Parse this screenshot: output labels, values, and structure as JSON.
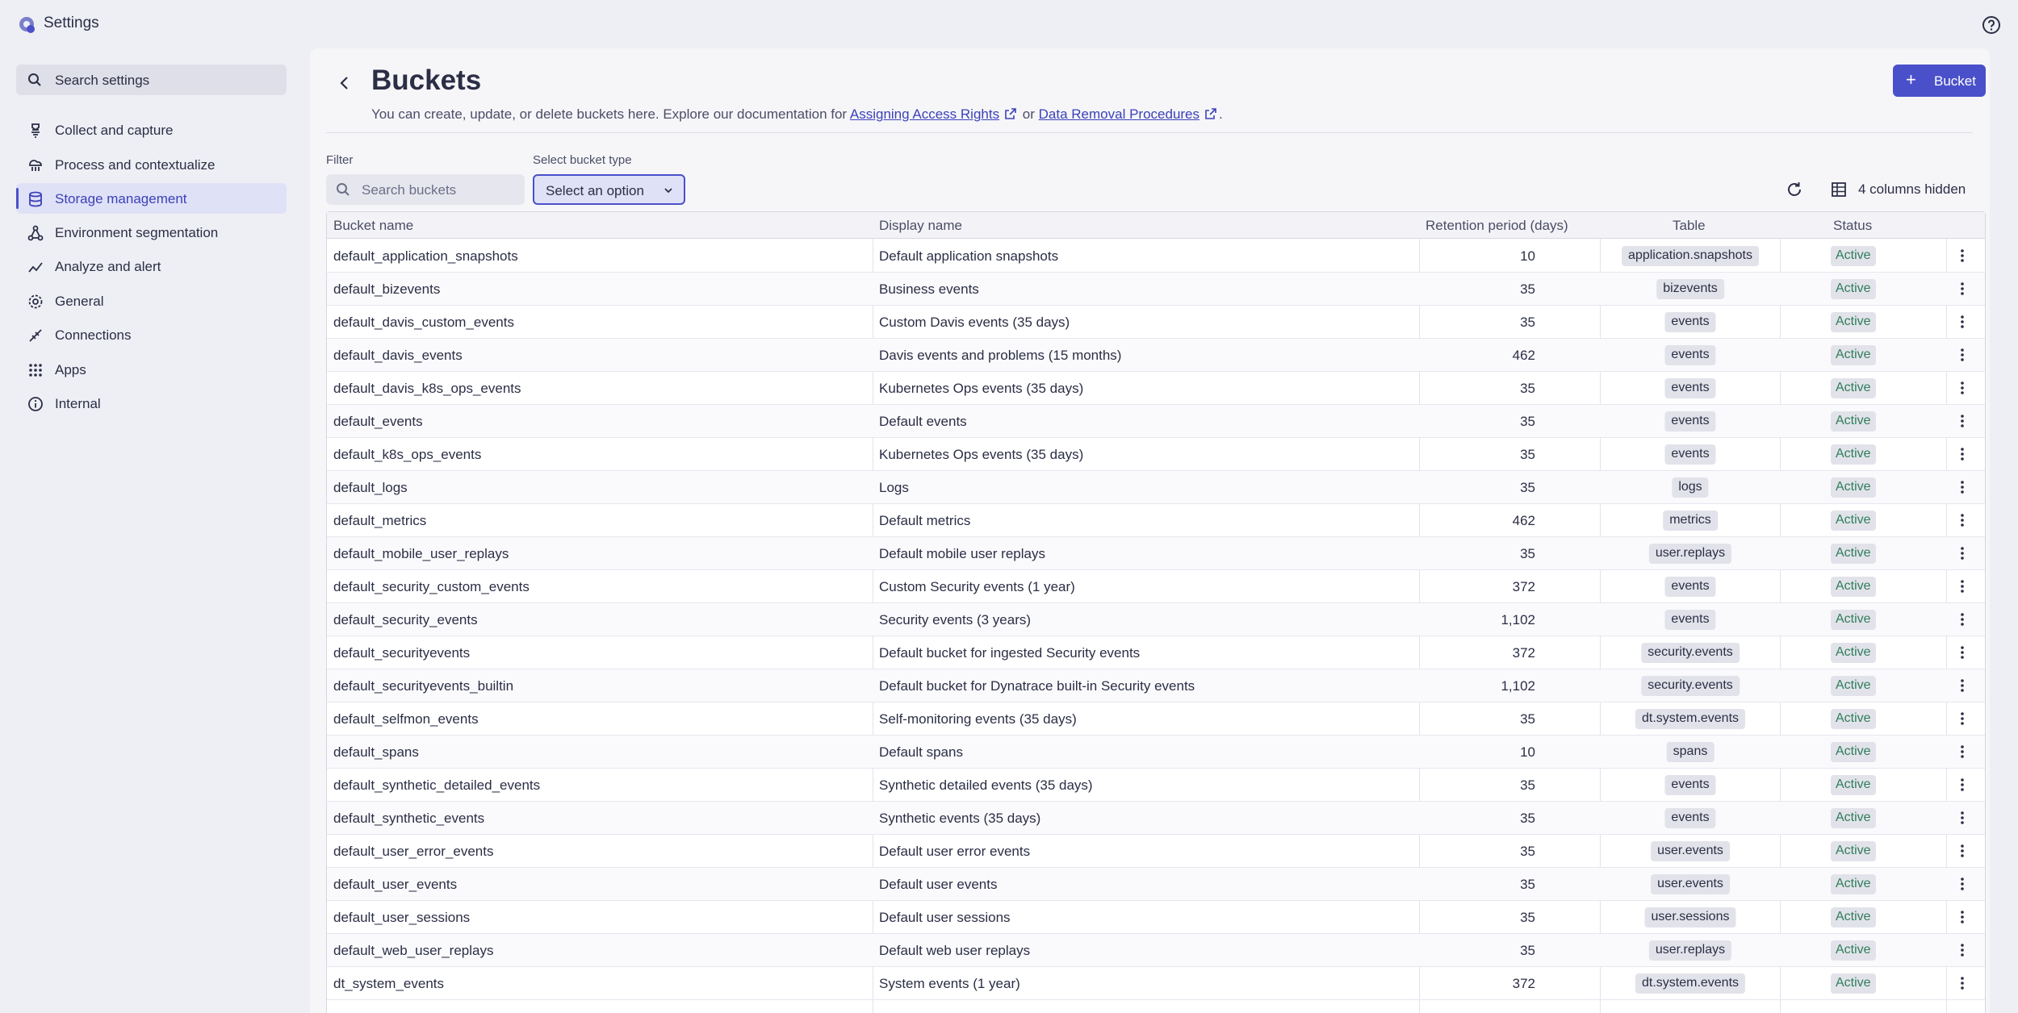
{
  "app": {
    "title": "Settings",
    "logo_icon": "settings-logo-icon",
    "help_icon": "help-icon"
  },
  "sidebar": {
    "search_label": "Search settings",
    "items": [
      {
        "label": "Collect and capture",
        "icon": "collect-icon"
      },
      {
        "label": "Process and contextualize",
        "icon": "process-icon"
      },
      {
        "label": "Storage management",
        "icon": "storage-icon",
        "active": true
      },
      {
        "label": "Environment segmentation",
        "icon": "segmentation-icon"
      },
      {
        "label": "Analyze and alert",
        "icon": "analyze-icon"
      },
      {
        "label": "General",
        "icon": "gear-icon"
      },
      {
        "label": "Connections",
        "icon": "connections-icon"
      },
      {
        "label": "Apps",
        "icon": "apps-grid-icon"
      },
      {
        "label": "Internal",
        "icon": "info-icon"
      }
    ]
  },
  "page": {
    "title": "Buckets",
    "desc_prefix": "You can create, update, or delete buckets here. Explore our documentation for ",
    "link1": "Assigning Access Rights",
    "desc_or": " or ",
    "link2": "Data Removal Procedures",
    "desc_suffix": ".",
    "add_button": "Bucket"
  },
  "filters": {
    "filter_label": "Filter",
    "search_placeholder": "Search buckets",
    "type_label": "Select bucket type",
    "type_value": "Select an option",
    "columns_hidden": "4 columns hidden"
  },
  "table": {
    "headers": [
      "Bucket name",
      "Display name",
      "Retention period (days)",
      "Table",
      "Status"
    ],
    "rows": [
      [
        "default_application_snapshots",
        "Default application snapshots",
        "10",
        "application.snapshots",
        "Active"
      ],
      [
        "default_bizevents",
        "Business events",
        "35",
        "bizevents",
        "Active"
      ],
      [
        "default_davis_custom_events",
        "Custom Davis events (35 days)",
        "35",
        "events",
        "Active"
      ],
      [
        "default_davis_events",
        "Davis events and problems (15 months)",
        "462",
        "events",
        "Active"
      ],
      [
        "default_davis_k8s_ops_events",
        "Kubernetes Ops events (35 days)",
        "35",
        "events",
        "Active"
      ],
      [
        "default_events",
        "Default events",
        "35",
        "events",
        "Active"
      ],
      [
        "default_k8s_ops_events",
        "Kubernetes Ops events (35 days)",
        "35",
        "events",
        "Active"
      ],
      [
        "default_logs",
        "Logs",
        "35",
        "logs",
        "Active"
      ],
      [
        "default_metrics",
        "Default metrics",
        "462",
        "metrics",
        "Active"
      ],
      [
        "default_mobile_user_replays",
        "Default mobile user replays",
        "35",
        "user.replays",
        "Active"
      ],
      [
        "default_security_custom_events",
        "Custom Security events (1 year)",
        "372",
        "events",
        "Active"
      ],
      [
        "default_security_events",
        "Security events (3 years)",
        "1,102",
        "events",
        "Active"
      ],
      [
        "default_securityevents",
        "Default bucket for ingested Security events",
        "372",
        "security.events",
        "Active"
      ],
      [
        "default_securityevents_builtin",
        "Default bucket for Dynatrace built-in Security events",
        "1,102",
        "security.events",
        "Active"
      ],
      [
        "default_selfmon_events",
        "Self-monitoring events (35 days)",
        "35",
        "dt.system.events",
        "Active"
      ],
      [
        "default_spans",
        "Default spans",
        "10",
        "spans",
        "Active"
      ],
      [
        "default_synthetic_detailed_events",
        "Synthetic detailed events (35 days)",
        "35",
        "events",
        "Active"
      ],
      [
        "default_synthetic_events",
        "Synthetic events (35 days)",
        "35",
        "events",
        "Active"
      ],
      [
        "default_user_error_events",
        "Default user error events",
        "35",
        "user.events",
        "Active"
      ],
      [
        "default_user_events",
        "Default user events",
        "35",
        "user.events",
        "Active"
      ],
      [
        "default_user_sessions",
        "Default user sessions",
        "35",
        "user.sessions",
        "Active"
      ],
      [
        "default_web_user_replays",
        "Default web user replays",
        "35",
        "user.replays",
        "Active"
      ],
      [
        "dt_system_events",
        "System events (1 year)",
        "372",
        "dt.system.events",
        "Active"
      ]
    ]
  }
}
